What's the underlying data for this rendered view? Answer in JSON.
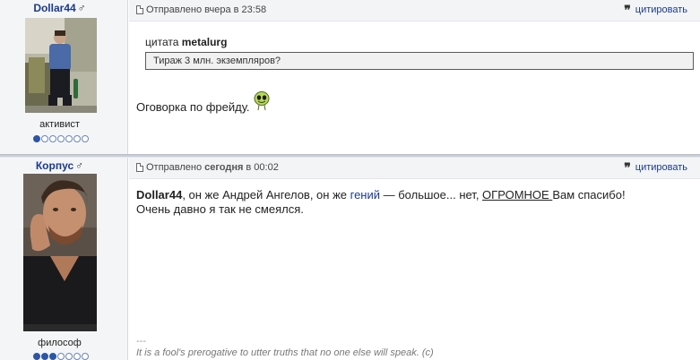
{
  "posts": [
    {
      "author": "Dollar44",
      "gender_icon": "♂",
      "rank": "активист",
      "rank_level": 1,
      "rank_max": 7,
      "posted_label": "Отправлено вчера в 23:58",
      "quote_button": "цитировать",
      "quote": {
        "prefix": "цитата",
        "author": "metalurg",
        "text": "Тираж 3 млн. экземпляров?"
      },
      "message": "Оговорка по фрейду.",
      "smiley_icon": "alien-smiley-icon"
    },
    {
      "author": "Корпус",
      "gender_icon": "♂",
      "rank": "философ",
      "rank_level": 3,
      "rank_max": 7,
      "posted_prefix": "Отправлено",
      "posted_day": "сегодня",
      "posted_time": "в 00:02",
      "quote_button": "цитировать",
      "message_parts": {
        "name": "Dollar44",
        "part1": ", он же Андрей Ангелов, он же ",
        "genius": "гений",
        "part2": " — большое... нет, ",
        "big": "ОГРОМНОЕ ",
        "part3": "Вам спасибо!",
        "line2": "Очень давно я так не смеялся."
      },
      "signature_sep": "---",
      "signature": "It is a fool's prerogative to utter truths that no one else will speak. (c)"
    }
  ],
  "colors": {
    "link": "#1a3a8c",
    "sidebar_bg": "#f4f5f7",
    "header_bg": "#f3f4f6",
    "rank_dot_on": "#2c56a4"
  }
}
